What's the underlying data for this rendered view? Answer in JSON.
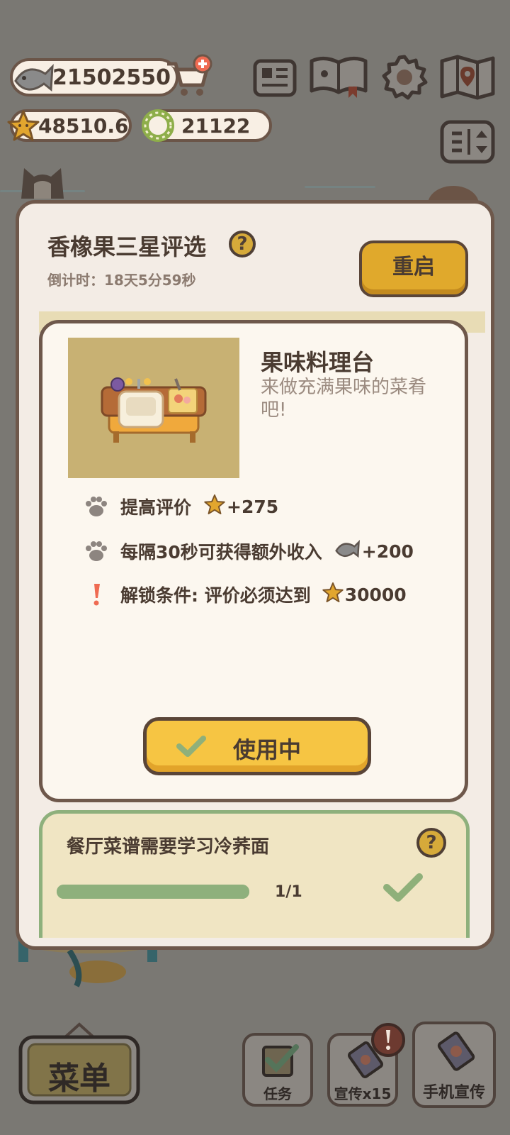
{
  "currency": {
    "fish": "21502550",
    "stars": "48510.6",
    "rings": "21122"
  },
  "modal": {
    "title": "香橡果三星评选",
    "countdown": "倒计时：18天5分59秒",
    "restart_label": "重启",
    "item": {
      "name": "果味料理台",
      "description": "来做充满果味的菜肴吧!",
      "stats": [
        {
          "icon": "paw-icon",
          "label": "提高评价",
          "reward_icon": "star-icon",
          "value": "+275"
        },
        {
          "icon": "paw-icon",
          "label": "每隔30秒可获得额外收入",
          "reward_icon": "fish-icon",
          "value": "+200"
        },
        {
          "icon": "exclamation-icon",
          "label": "解锁条件: 评价必须达到",
          "reward_icon": "star-icon",
          "value": "30000"
        }
      ],
      "use_label": "使用中"
    },
    "task": {
      "text": "餐厅菜谱需要学习冷荞面",
      "progress": "1/1",
      "progress_fraction": 1.0
    }
  },
  "bottom_bar": {
    "menu_label": "菜单",
    "tasks_label": "任务",
    "promo_label": "宣传x15",
    "phone_promo_label": "手机宣传"
  },
  "colors": {
    "accent_yellow": "#f6c543",
    "frame_brown": "#6e584b",
    "task_green": "#8eb07c",
    "alert_red": "#ef6b52"
  }
}
